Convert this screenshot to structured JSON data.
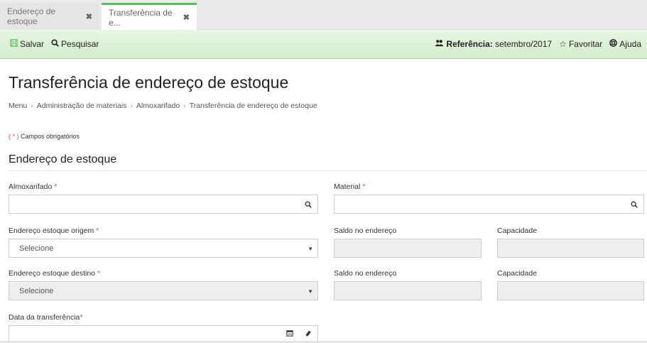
{
  "tabs": [
    {
      "label": "Endereço de estoque",
      "close": "✖"
    },
    {
      "label": "Transferência de e...",
      "close": "✖"
    }
  ],
  "toolbar": {
    "save_label": "Salvar",
    "search_label": "Pesquisar",
    "reference_label": "Referência:",
    "reference_value": "setembro/2017",
    "favorite_label": "Favoritar",
    "help_label": "Ajuda"
  },
  "page": {
    "title": "Transferência de endereço de estoque",
    "breadcrumb": [
      "Menu",
      "Administração de materiais",
      "Almoxarifado",
      "Transferência de endereço de estoque"
    ],
    "required_note_star": "( * )",
    "required_note_text": "Campos obrigatórios"
  },
  "section": {
    "title": "Endereço de estoque"
  },
  "fields": {
    "almoxarifado_label": "Almoxarifado",
    "material_label": "Material",
    "origem_label": "Endereço estoque origem",
    "origem_value": "Selecione",
    "saldo1_label": "Saldo no endereço",
    "capacidade1_label": "Capacidade",
    "destino_label": "Endereço estoque destino",
    "destino_value": "Selecione",
    "saldo2_label": "Saldo no endereço",
    "capacidade2_label": "Capacidade",
    "data_label": "Data da transferência",
    "required_star": "*"
  },
  "icons": {
    "save": "floppy-icon",
    "search": "search-icon",
    "reference": "users-icon",
    "favorite": "star-icon",
    "help": "lifebuoy-icon",
    "calendar": "calendar-icon",
    "eraser": "eraser-icon",
    "caret": "caret-down-icon"
  },
  "colors": {
    "accent": "#5cb85c",
    "toolbar_bg": "#dff0d8",
    "required": "#d9534f"
  }
}
